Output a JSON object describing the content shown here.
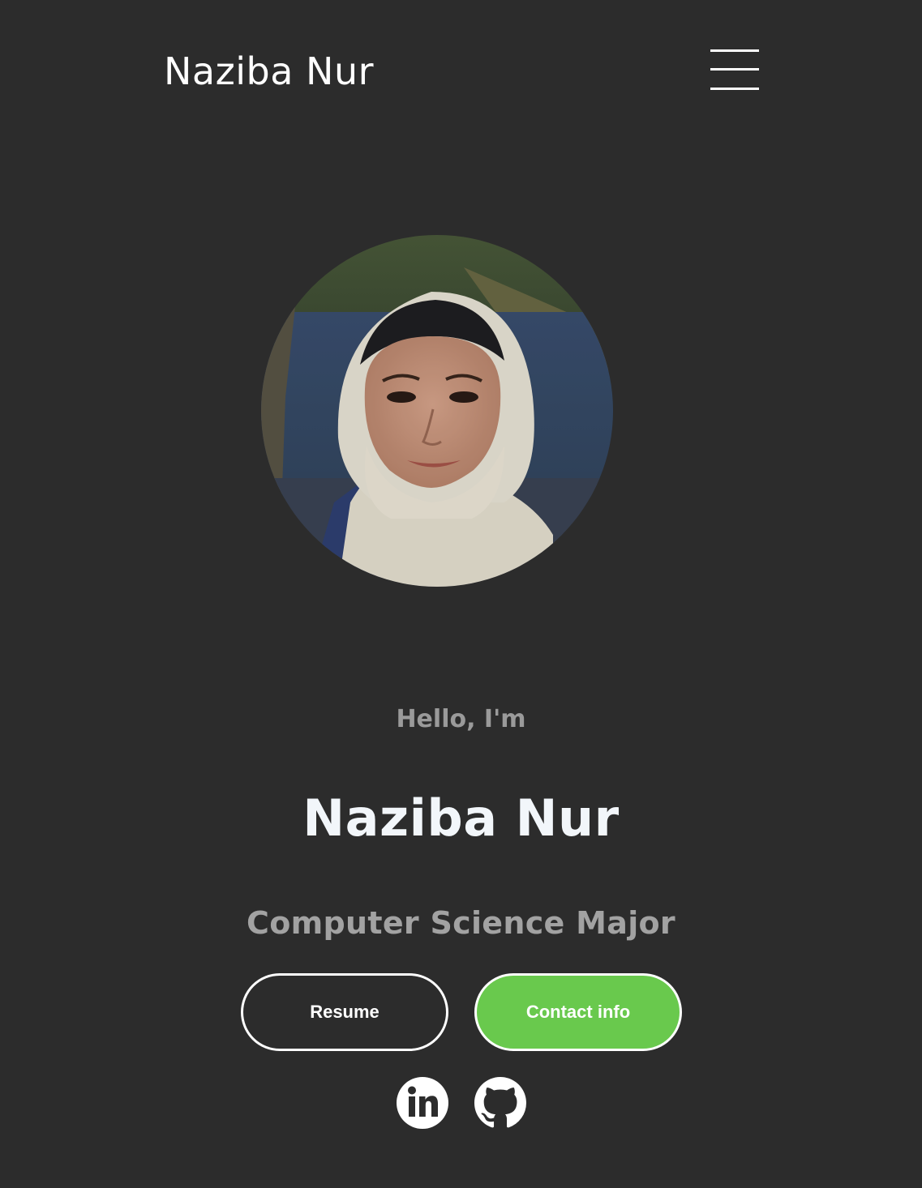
{
  "nav": {
    "logo_text": "Naziba Nur",
    "menu_icon": "hamburger-menu-icon"
  },
  "hero": {
    "photo_alt": "Profile picture",
    "greeting": "Hello, I'm",
    "name": "Naziba Nur",
    "subtitle": "Computer Science Major"
  },
  "buttons": {
    "resume_label": "Resume",
    "contact_label": "Contact info"
  },
  "socials": [
    {
      "icon": "linkedin-icon"
    },
    {
      "icon": "github-icon"
    }
  ],
  "colors": {
    "background": "#2c2c2c",
    "accent_green": "#69c94d",
    "heading_white": "#f2f6fa",
    "muted_gray": "#9a9a9a"
  }
}
